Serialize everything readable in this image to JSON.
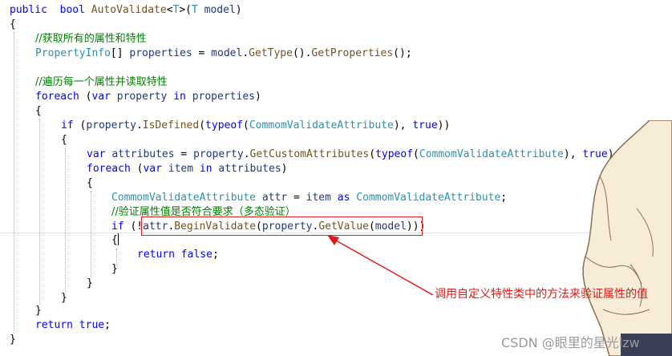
{
  "code": {
    "l1": {
      "kw1": "public",
      "kw2": "bool",
      "method": "AutoValidate",
      "open": "<",
      "tparam": "T",
      "close": ">(",
      "ptype": "T",
      "pname": "model",
      "end": ")"
    },
    "l2": {
      "brace": "{"
    },
    "l3": {
      "comment": "//获取所有的属性和特性"
    },
    "l4": {
      "type": "PropertyInfo",
      "brackets": "[]",
      "var": "properties",
      "eq": " = ",
      "obj": "model",
      "dot1": ".",
      "m1": "GetType",
      "call1": "().",
      "m2": "GetProperties",
      "call2": "();"
    },
    "l5": {
      "comment": "//遍历每一个属性并读取特性"
    },
    "l6": {
      "kw": "foreach",
      "p1": " (",
      "kwvar": "var",
      "var": "property",
      "kwin": "in",
      "coll": "properties",
      "p2": ")"
    },
    "l7": {
      "brace": "{"
    },
    "l8": {
      "kw": "if",
      "p1": " (",
      "obj": "property",
      "dot": ".",
      "m": "IsDefined",
      "p2": "(",
      "kwt": "typeof",
      "p3": "(",
      "type": "CommomValidateAttribute",
      "p4": "), ",
      "kwtrue": "true",
      "p5": "))"
    },
    "l9": {
      "brace": "{"
    },
    "l10": {
      "kwvar": "var",
      "var": "attributes",
      "eq": " = ",
      "obj": "property",
      "dot": ".",
      "m": "GetCustomAttributes",
      "p1": "(",
      "kwt": "typeof",
      "p2": "(",
      "type": "CommomValidateAttribute",
      "p3": "), ",
      "kwtrue": "true",
      "p4": ");"
    },
    "l11": {
      "kw": "foreach",
      "p1": " (",
      "kwvar": "var",
      "var": "item",
      "kwin": "in",
      "coll": "attributes",
      "p2": ")"
    },
    "l12": {
      "brace": "{"
    },
    "l13": {
      "type": "CommomValidateAttribute",
      "var": "attr",
      "eq": " = ",
      "obj": "item",
      "kwas": "as",
      "type2": "CommomValidateAttribute",
      "end": ";"
    },
    "l14": {
      "comment": "//验证属性值是否符合要求（多态验证）"
    },
    "l15": {
      "kw": "if",
      "p1": " (!",
      "obj": "attr",
      "dot": ".",
      "m": "BeginValidate",
      "p2": "(",
      "obj2": "property",
      "dot2": ".",
      "m2": "GetValue",
      "p3": "(",
      "arg": "model",
      "p4": "))",
      "p5": ")"
    },
    "l16": {
      "brace": "{"
    },
    "l17": {
      "kw": "return",
      "kwfalse": "false",
      "end": ";"
    },
    "l18": {
      "brace": "}"
    },
    "l19": {
      "brace": "}"
    },
    "l20": {
      "brace": "}"
    },
    "l21": {
      "brace": "}"
    },
    "l22": {
      "kw": "return",
      "kwtrue": "true",
      "end": ";"
    },
    "l23": {
      "brace": "}"
    }
  },
  "annotation": {
    "text": "调用自定义特性类中的方法来验证属性的值"
  },
  "watermark": {
    "text": "CSDN @眼里的星光lzw"
  },
  "colors": {
    "keyword": "#0000ff",
    "type": "#2b91af",
    "comment": "#008000",
    "identifier": "#1f377f",
    "method": "#74531f",
    "annotation": "#e01818",
    "highlight_box": "#e02020"
  }
}
